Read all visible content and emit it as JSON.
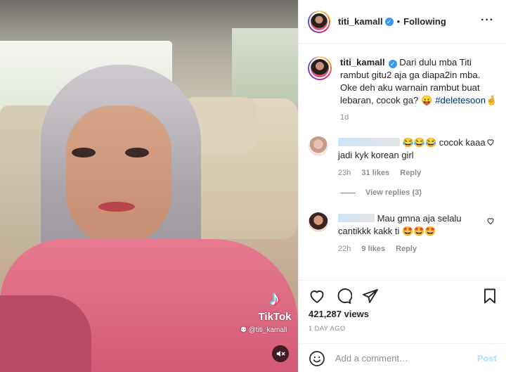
{
  "post": {
    "username": "titi_kamall",
    "follow_status": "Following",
    "separator": "•",
    "more_icon": "more-options-icon"
  },
  "caption": {
    "username": "titi_kamall",
    "text": "Dari dulu mba Titi rambut gitu2 aja ga diapa2in mba. Oke deh aku warnain rambut buat lebaran, cocok ga? 😛 ",
    "hashtag": "#deletesoon",
    "tail_emoji": "🤞",
    "time": "1d"
  },
  "comments": [
    {
      "text": "😂😂😂 cocok kaaa jadi kyk korean girl",
      "time": "23h",
      "likes": "31 likes",
      "reply": "Reply",
      "view_replies": "View replies (3)"
    },
    {
      "text": "Mau gmna aja selalu cantikkk kakk ti 🤩🤩🤩",
      "time": "22h",
      "likes": "9 likes",
      "reply": "Reply"
    }
  ],
  "stats": {
    "views": "421,287 views",
    "date": "1 DAY AGO"
  },
  "add_comment": {
    "placeholder": "Add a comment…",
    "post_label": "Post"
  },
  "video": {
    "watermark_brand": "TikTok",
    "watermark_user": "@titi_kamall",
    "mute_icon": "speaker-muted-icon"
  },
  "colors": {
    "link": "#00376b",
    "verified": "#3897f0",
    "muted_text": "#8e8e8e",
    "post_button_disabled": "#b2dffc"
  }
}
